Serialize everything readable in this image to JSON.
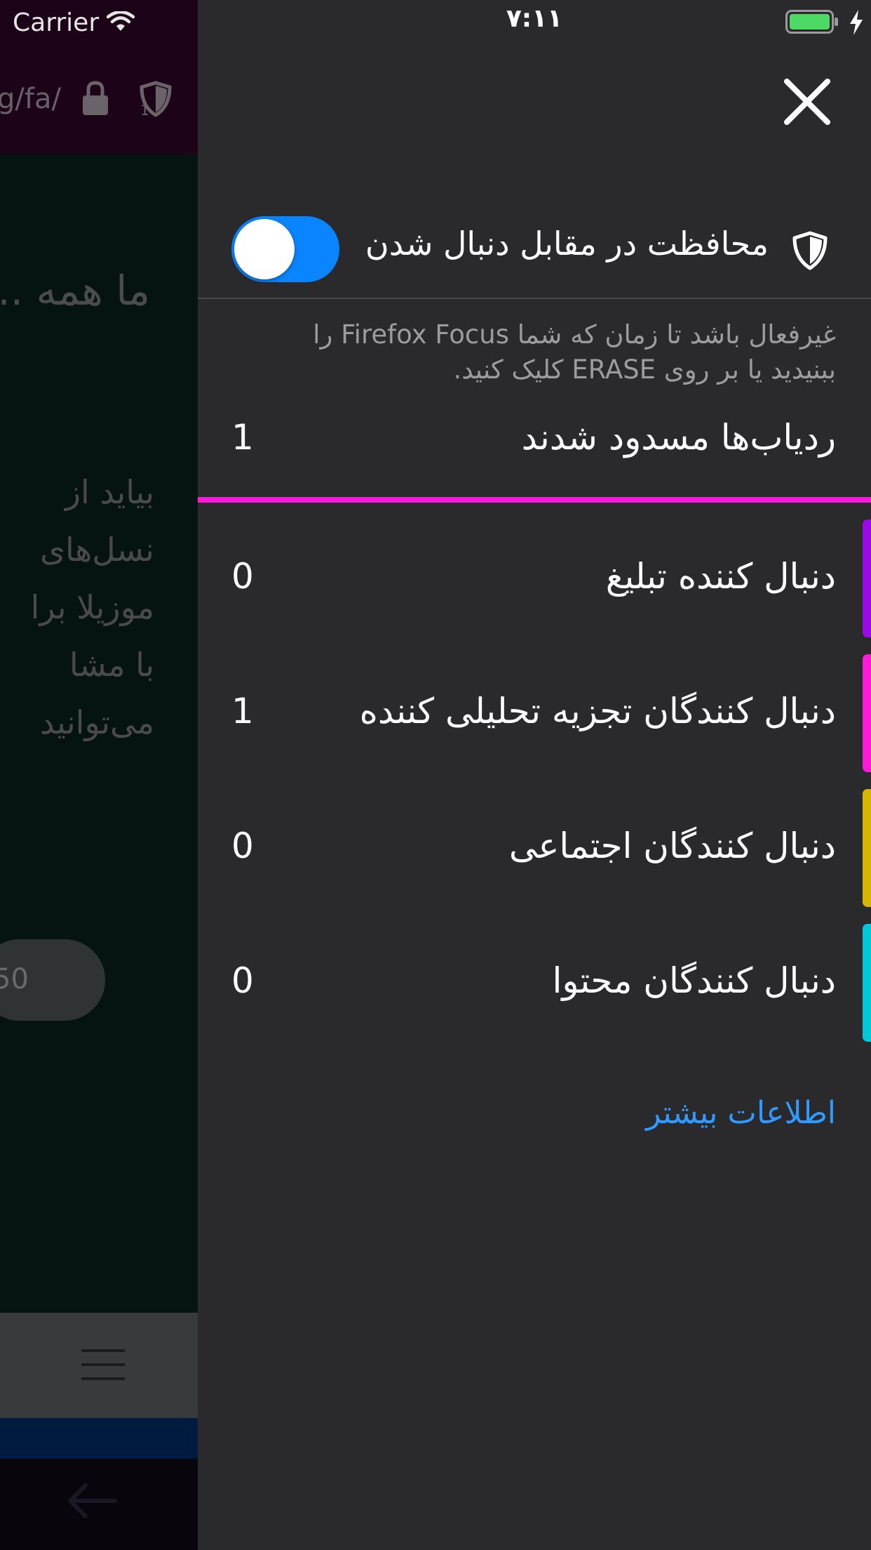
{
  "status_bar": {
    "carrier": "Carrier",
    "time": "۷:۱۱",
    "battery_color": "#4cd964"
  },
  "background_page": {
    "url_fragment": "g/fa/",
    "heading_fragment": "ما همه ...",
    "paragraph_lines": [
      "بیاید از",
      "نسل‌های",
      "موزیلا برا",
      "با مشا",
      "می‌توانید"
    ],
    "pill_text": "50",
    "icons": [
      "wifi-icon",
      "lock-icon",
      "tracking-shield-icon",
      "menu-icon",
      "back-arrow-icon"
    ]
  },
  "panel": {
    "close_icon": "close-icon",
    "toggle": {
      "label": "محافظت در مقابل دنبال شدن",
      "state": "on",
      "color": "#0a84ff"
    },
    "description": "غیرفعال باشد تا زمان که شما Firefox Focus را ببنیدید یا بر روی ERASE کلیک کنید.",
    "blocked": {
      "label": "ردیاب‌ها مسدود شدند",
      "count": "1",
      "line_color": "#ff1ad9"
    },
    "categories": [
      {
        "label": "دنبال کننده تبلیغ",
        "count": "0",
        "color": "#9b0ae6"
      },
      {
        "label": "دنبال کنندگان تجزیه تحلیلی کننده",
        "count": "1",
        "color": "#ff1ad9"
      },
      {
        "label": "دنبال کنندگان اجتماعی",
        "count": "0",
        "color": "#d7b600"
      },
      {
        "label": "دنبال کنندگان محتوا",
        "count": "0",
        "color": "#00c8d7"
      }
    ],
    "learn_more": "اطلاعات بیشتر",
    "link_color": "#2f9bff"
  }
}
